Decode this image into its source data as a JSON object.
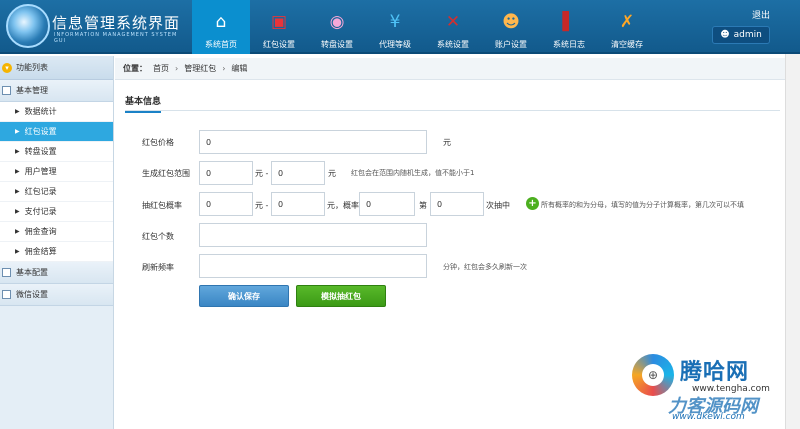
{
  "app": {
    "title": "信息管理系统界面",
    "subtitle": "INFORMATION MANAGEMENT SYSTEM GUI"
  },
  "nav": [
    {
      "label": "系统首页",
      "icon": "home-icon",
      "glyph": "⌂",
      "color": "#ffffff"
    },
    {
      "label": "红包设置",
      "icon": "red-packet-icon",
      "glyph": "▣",
      "color": "#e8343a"
    },
    {
      "label": "转盘设置",
      "icon": "wheel-icon",
      "glyph": "◉",
      "color": "#f7a8d8"
    },
    {
      "label": "代理等级",
      "icon": "currency-icon",
      "glyph": "¥",
      "color": "#4fc3f7"
    },
    {
      "label": "系统设置",
      "icon": "tools-icon",
      "glyph": "✕",
      "color": "#d32f2f"
    },
    {
      "label": "账户设置",
      "icon": "user-icon",
      "glyph": "☻",
      "color": "#ffb74d"
    },
    {
      "label": "系统日志",
      "icon": "log-book-icon",
      "glyph": "▌",
      "color": "#c62828"
    },
    {
      "label": "清空缓存",
      "icon": "clear-cache-icon",
      "glyph": "✗",
      "color": "#ffa726"
    }
  ],
  "topbar": {
    "logout": "退出",
    "user": "admin"
  },
  "sidebar": {
    "header": "功能列表",
    "groups": [
      {
        "label": "基本管理",
        "items": [
          {
            "label": "数据统计"
          },
          {
            "label": "红包设置"
          },
          {
            "label": "转盘设置"
          },
          {
            "label": "用户管理"
          },
          {
            "label": "红包记录"
          },
          {
            "label": "支付记录"
          },
          {
            "label": "佣金查询"
          },
          {
            "label": "佣金结算"
          }
        ]
      },
      {
        "label": "基本配置"
      },
      {
        "label": "微信设置"
      }
    ]
  },
  "breadcrumb": {
    "prefix": "位置：",
    "items": [
      "首页",
      "管理红包",
      "编辑"
    ]
  },
  "form": {
    "section_title": "基本信息",
    "price": {
      "label": "红包价格",
      "value": "0",
      "unit": "元"
    },
    "range": {
      "label": "生成红包范围",
      "min": "0",
      "min_unit": "元 -",
      "max": "0",
      "max_unit": "元",
      "hint": "红包会在范围内随机生成，值不能小于1"
    },
    "probability": {
      "label": "抽红包概率",
      "min": "0",
      "min_unit": "元 -",
      "max": "0",
      "rate_label": "元，概率",
      "rate": "0",
      "nth_label": "第",
      "nth": "0",
      "nth_unit": "次抽中",
      "hint": "所有概率的和为分母，填写的值为分子计算概率，第几次可以不填"
    },
    "count": {
      "label": "红包个数",
      "value": ""
    },
    "refresh": {
      "label": "刷新频率",
      "value": "",
      "hint": "分钟，红包会多久刷新一次"
    },
    "save_button": "确认保存",
    "simulate_button": "模拟抽红包"
  },
  "watermark": {
    "brand": "腾哈网",
    "url1": "www.tengha.com",
    "brand2": "力客源码网",
    "url2": "www.dkewl.com"
  }
}
